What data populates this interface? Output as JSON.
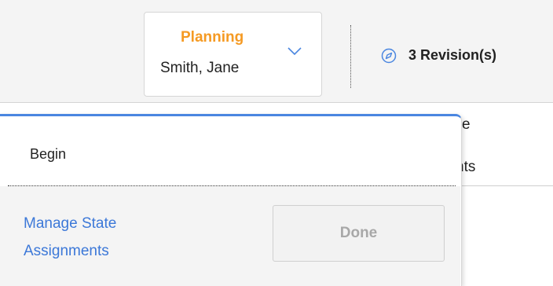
{
  "toolbar": {
    "state": {
      "name": "Planning",
      "owner": "Smith, Jane",
      "name_color": "#f59a23",
      "chevron_icon": "chevron-down-icon"
    },
    "revisions": {
      "icon": "compass-edit-icon",
      "label": "3 Revision(s)"
    }
  },
  "background": {
    "cell_1": "e",
    "cell_2": "nts"
  },
  "state_menu": {
    "items": [
      {
        "label": "Begin"
      }
    ],
    "accent_color": "#4a86e0",
    "footer": {
      "manage_link": "Manage State Assignments",
      "done_label": "Done"
    }
  }
}
